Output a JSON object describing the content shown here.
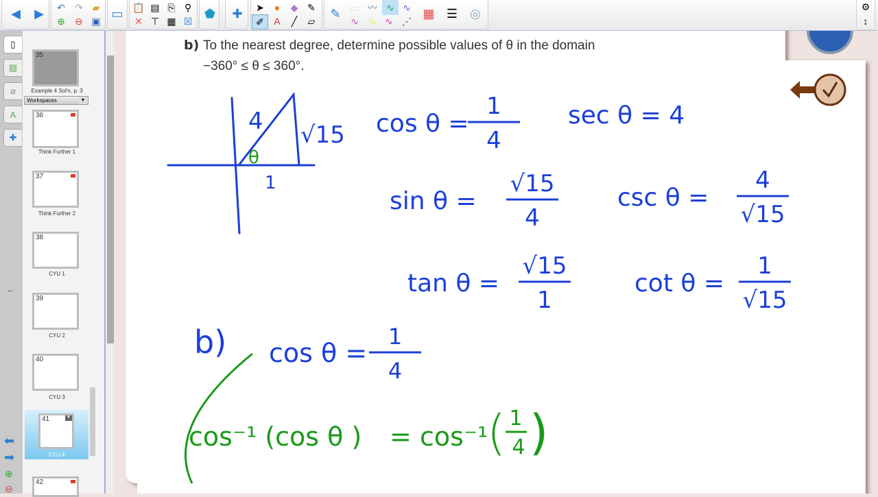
{
  "toolbar": {
    "buttons": [
      "back",
      "forward",
      "undo",
      "redo",
      "open",
      "new-page",
      "delete-page",
      "save",
      "screen-shade",
      "paste",
      "capture",
      "clear",
      "table",
      "insert-math",
      "addons",
      "select",
      "fill",
      "eraser-shapes",
      "magic-pen",
      "pens",
      "text",
      "line",
      "eraser",
      "pen-style",
      "color",
      "line-style",
      "transparency",
      "settings",
      "toggle-position"
    ]
  },
  "sorter": {
    "workspaces_label": "Workspaces",
    "pages": [
      {
        "num": "35",
        "label": "Example 4 Sol'n, p. 3"
      },
      {
        "num": "36",
        "label": "Think Further 1"
      },
      {
        "num": "37",
        "label": "Think Further 2"
      },
      {
        "num": "38",
        "label": "CYU 1"
      },
      {
        "num": "39",
        "label": "CYU 2"
      },
      {
        "num": "40",
        "label": "CYU 3"
      },
      {
        "num": "41",
        "label": "CYU 4",
        "selected": true
      },
      {
        "num": "42",
        "label": ""
      }
    ]
  },
  "page": {
    "question_label": "b)",
    "question_line1": "To the nearest degree, determine possible values of θ in the domain",
    "question_line2": "−360° ≤ θ ≤ 360°.",
    "triangle": {
      "hyp": "4",
      "opp": "√15",
      "adj": "1",
      "angle": "θ"
    },
    "ratios": [
      {
        "lhs": "cos θ =",
        "num": "1",
        "den": "4"
      },
      {
        "lhs": "sec θ = 4"
      },
      {
        "lhs": "sin θ =",
        "num": "√15",
        "den": "4"
      },
      {
        "lhs": "csc θ =",
        "num": "4",
        "den": "√15"
      },
      {
        "lhs": "tan θ =",
        "num": "√15",
        "den": "1"
      },
      {
        "lhs": "cot θ =",
        "num": "1",
        "den": "√15"
      }
    ],
    "part_b": {
      "label": "b)",
      "lhs": "cos θ =",
      "num": "1",
      "den": "4"
    },
    "inverse": {
      "left": "cos⁻¹ (cos θ )",
      "eq": "=",
      "right": "cos⁻¹",
      "num": "1",
      "den": "4"
    }
  },
  "colors": {
    "blue_ink": "#1b3fd8",
    "green_ink": "#1a9a1a",
    "brown": "#7a3a10"
  }
}
